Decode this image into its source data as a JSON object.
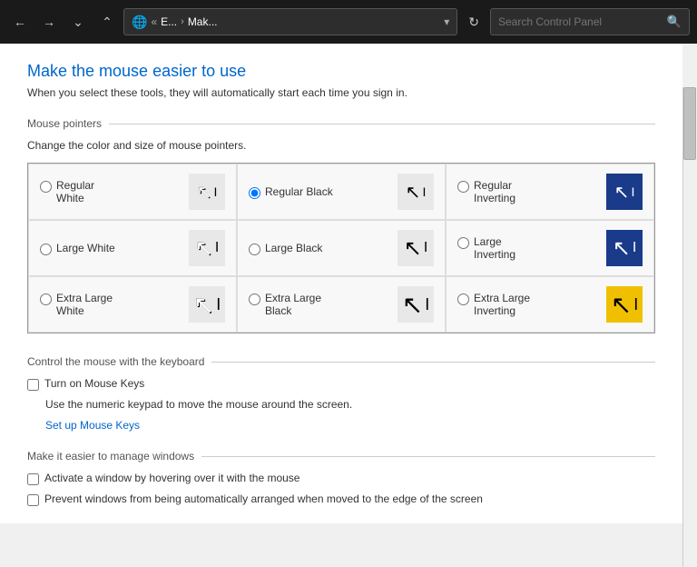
{
  "nav": {
    "back_btn": "‹",
    "forward_btn": "›",
    "down_btn": "⌄",
    "up_btn": "⌃",
    "address_icon": "🌐",
    "address_parts": [
      "E...",
      "Mak..."
    ],
    "refresh_btn": "↻",
    "search_placeholder": "Search Control Panel",
    "search_icon": "🔍"
  },
  "page": {
    "title": "Make the mouse easier to use",
    "subtitle": "When you select these tools, they will automatically start each time you sign in."
  },
  "sections": {
    "mouse_pointers": {
      "title": "Mouse pointers",
      "desc": "Change the color and size of mouse pointers.",
      "options": [
        {
          "id": "regular-white",
          "label": "Regular White",
          "checked": false,
          "preview_type": "regular-white"
        },
        {
          "id": "regular-black",
          "label": "Regular Black",
          "checked": true,
          "preview_type": "regular-black"
        },
        {
          "id": "regular-inverting",
          "label": "Regular Inverting",
          "checked": false,
          "preview_type": "regular-inverting"
        },
        {
          "id": "large-white",
          "label": "Large White",
          "checked": false,
          "preview_type": "large-white"
        },
        {
          "id": "large-black",
          "label": "Large Black",
          "checked": false,
          "preview_type": "large-black"
        },
        {
          "id": "large-inverting",
          "label": "Large Inverting",
          "checked": false,
          "preview_type": "large-inverting"
        },
        {
          "id": "xl-white",
          "label": "Extra Large White",
          "checked": false,
          "preview_type": "xl-white"
        },
        {
          "id": "xl-black",
          "label": "Extra Large Black",
          "checked": false,
          "preview_type": "xl-black"
        },
        {
          "id": "xl-inverting",
          "label": "Extra Large Inverting",
          "checked": false,
          "preview_type": "xl-inverting"
        }
      ]
    },
    "keyboard_mouse": {
      "title": "Control the mouse with the keyboard",
      "turn_on_label": "Turn on Mouse Keys",
      "turn_on_checked": false,
      "desc": "Use the numeric keypad to move the mouse around the screen.",
      "setup_link": "Set up Mouse Keys"
    },
    "manage_windows": {
      "title": "Make it easier to manage windows",
      "option1_label": "Activate a window by hovering over it with the mouse",
      "option1_checked": false,
      "option2_label": "Prevent windows from being automatically arranged when moved to the edge of the screen",
      "option2_checked": false
    }
  }
}
